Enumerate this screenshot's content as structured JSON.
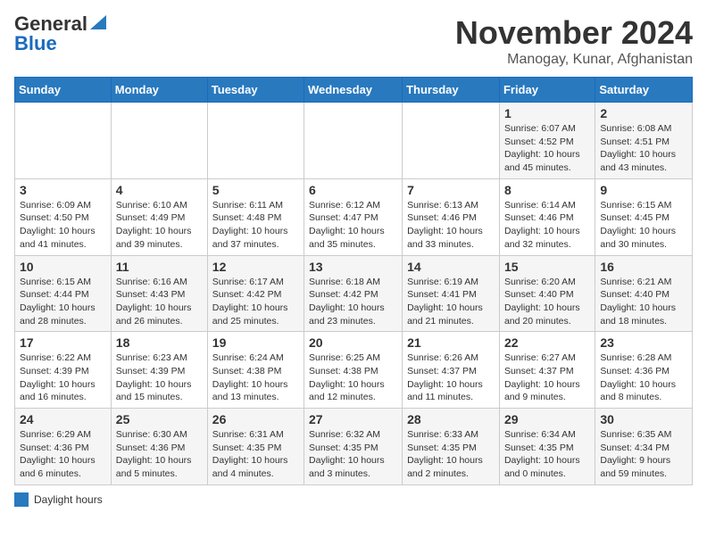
{
  "header": {
    "logo_general": "General",
    "logo_blue": "Blue",
    "title": "November 2024",
    "subtitle": "Manogay, Kunar, Afghanistan"
  },
  "calendar": {
    "days_of_week": [
      "Sunday",
      "Monday",
      "Tuesday",
      "Wednesday",
      "Thursday",
      "Friday",
      "Saturday"
    ],
    "weeks": [
      [
        {
          "day": "",
          "info": ""
        },
        {
          "day": "",
          "info": ""
        },
        {
          "day": "",
          "info": ""
        },
        {
          "day": "",
          "info": ""
        },
        {
          "day": "",
          "info": ""
        },
        {
          "day": "1",
          "info": "Sunrise: 6:07 AM\nSunset: 4:52 PM\nDaylight: 10 hours and 45 minutes."
        },
        {
          "day": "2",
          "info": "Sunrise: 6:08 AM\nSunset: 4:51 PM\nDaylight: 10 hours and 43 minutes."
        }
      ],
      [
        {
          "day": "3",
          "info": "Sunrise: 6:09 AM\nSunset: 4:50 PM\nDaylight: 10 hours and 41 minutes."
        },
        {
          "day": "4",
          "info": "Sunrise: 6:10 AM\nSunset: 4:49 PM\nDaylight: 10 hours and 39 minutes."
        },
        {
          "day": "5",
          "info": "Sunrise: 6:11 AM\nSunset: 4:48 PM\nDaylight: 10 hours and 37 minutes."
        },
        {
          "day": "6",
          "info": "Sunrise: 6:12 AM\nSunset: 4:47 PM\nDaylight: 10 hours and 35 minutes."
        },
        {
          "day": "7",
          "info": "Sunrise: 6:13 AM\nSunset: 4:46 PM\nDaylight: 10 hours and 33 minutes."
        },
        {
          "day": "8",
          "info": "Sunrise: 6:14 AM\nSunset: 4:46 PM\nDaylight: 10 hours and 32 minutes."
        },
        {
          "day": "9",
          "info": "Sunrise: 6:15 AM\nSunset: 4:45 PM\nDaylight: 10 hours and 30 minutes."
        }
      ],
      [
        {
          "day": "10",
          "info": "Sunrise: 6:15 AM\nSunset: 4:44 PM\nDaylight: 10 hours and 28 minutes."
        },
        {
          "day": "11",
          "info": "Sunrise: 6:16 AM\nSunset: 4:43 PM\nDaylight: 10 hours and 26 minutes."
        },
        {
          "day": "12",
          "info": "Sunrise: 6:17 AM\nSunset: 4:42 PM\nDaylight: 10 hours and 25 minutes."
        },
        {
          "day": "13",
          "info": "Sunrise: 6:18 AM\nSunset: 4:42 PM\nDaylight: 10 hours and 23 minutes."
        },
        {
          "day": "14",
          "info": "Sunrise: 6:19 AM\nSunset: 4:41 PM\nDaylight: 10 hours and 21 minutes."
        },
        {
          "day": "15",
          "info": "Sunrise: 6:20 AM\nSunset: 4:40 PM\nDaylight: 10 hours and 20 minutes."
        },
        {
          "day": "16",
          "info": "Sunrise: 6:21 AM\nSunset: 4:40 PM\nDaylight: 10 hours and 18 minutes."
        }
      ],
      [
        {
          "day": "17",
          "info": "Sunrise: 6:22 AM\nSunset: 4:39 PM\nDaylight: 10 hours and 16 minutes."
        },
        {
          "day": "18",
          "info": "Sunrise: 6:23 AM\nSunset: 4:39 PM\nDaylight: 10 hours and 15 minutes."
        },
        {
          "day": "19",
          "info": "Sunrise: 6:24 AM\nSunset: 4:38 PM\nDaylight: 10 hours and 13 minutes."
        },
        {
          "day": "20",
          "info": "Sunrise: 6:25 AM\nSunset: 4:38 PM\nDaylight: 10 hours and 12 minutes."
        },
        {
          "day": "21",
          "info": "Sunrise: 6:26 AM\nSunset: 4:37 PM\nDaylight: 10 hours and 11 minutes."
        },
        {
          "day": "22",
          "info": "Sunrise: 6:27 AM\nSunset: 4:37 PM\nDaylight: 10 hours and 9 minutes."
        },
        {
          "day": "23",
          "info": "Sunrise: 6:28 AM\nSunset: 4:36 PM\nDaylight: 10 hours and 8 minutes."
        }
      ],
      [
        {
          "day": "24",
          "info": "Sunrise: 6:29 AM\nSunset: 4:36 PM\nDaylight: 10 hours and 6 minutes."
        },
        {
          "day": "25",
          "info": "Sunrise: 6:30 AM\nSunset: 4:36 PM\nDaylight: 10 hours and 5 minutes."
        },
        {
          "day": "26",
          "info": "Sunrise: 6:31 AM\nSunset: 4:35 PM\nDaylight: 10 hours and 4 minutes."
        },
        {
          "day": "27",
          "info": "Sunrise: 6:32 AM\nSunset: 4:35 PM\nDaylight: 10 hours and 3 minutes."
        },
        {
          "day": "28",
          "info": "Sunrise: 6:33 AM\nSunset: 4:35 PM\nDaylight: 10 hours and 2 minutes."
        },
        {
          "day": "29",
          "info": "Sunrise: 6:34 AM\nSunset: 4:35 PM\nDaylight: 10 hours and 0 minutes."
        },
        {
          "day": "30",
          "info": "Sunrise: 6:35 AM\nSunset: 4:34 PM\nDaylight: 9 hours and 59 minutes."
        }
      ]
    ]
  },
  "footer": {
    "label": "Daylight hours"
  }
}
